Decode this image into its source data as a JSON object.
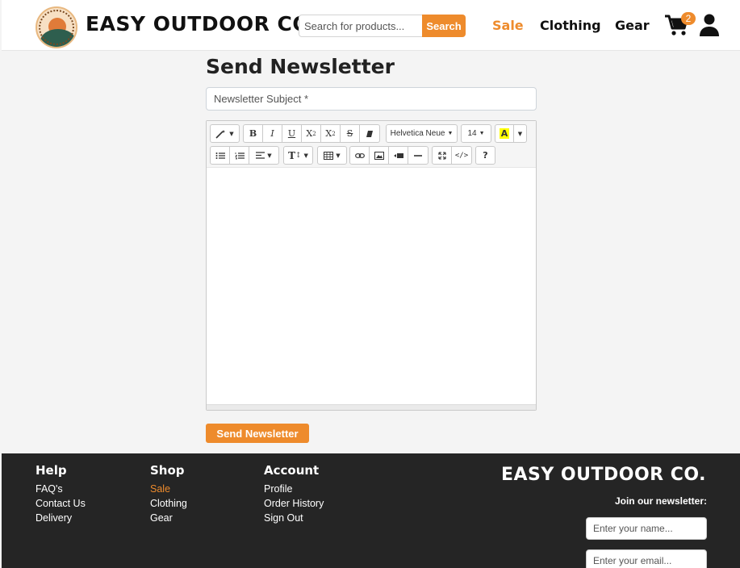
{
  "header": {
    "brand": "EASY OUTDOOR CO.",
    "search": {
      "placeholder": "Search for products...",
      "button": "Search"
    },
    "nav": {
      "sale": "Sale",
      "clothing": "Clothing",
      "gear": "Gear"
    },
    "cart_count": "2",
    "accent_color": "#ee8b2c"
  },
  "main": {
    "title": "Send Newsletter",
    "subject_placeholder": "Newsletter Subject *",
    "toolbar": {
      "font_family": "Helvetica Neue",
      "font_size": "14",
      "icons": [
        "magic-icon",
        "bold-icon",
        "italic-icon",
        "underline-icon",
        "superscript-icon",
        "subscript-icon",
        "strikethrough-icon",
        "eraser-icon",
        "font-family-select",
        "font-size-select",
        "highlight-icon",
        "unordered-list-icon",
        "ordered-list-icon",
        "align-icon",
        "line-height-icon",
        "table-icon",
        "link-icon",
        "image-icon",
        "video-icon",
        "hr-icon",
        "fullscreen-icon",
        "code-icon",
        "help-icon"
      ]
    },
    "send_button": "Send Newsletter"
  },
  "footer": {
    "help": {
      "heading": "Help",
      "links": [
        "FAQ's",
        "Contact Us",
        "Delivery"
      ]
    },
    "shop": {
      "heading": "Shop",
      "links": [
        "Sale",
        "Clothing",
        "Gear"
      ]
    },
    "account": {
      "heading": "Account",
      "links": [
        "Profile",
        "Order History",
        "Sign Out"
      ]
    },
    "brand": "EASY OUTDOOR CO.",
    "newsletter_label": "Join our newsletter:",
    "name_placeholder": "Enter your name...",
    "email_placeholder": "Enter your email..."
  }
}
